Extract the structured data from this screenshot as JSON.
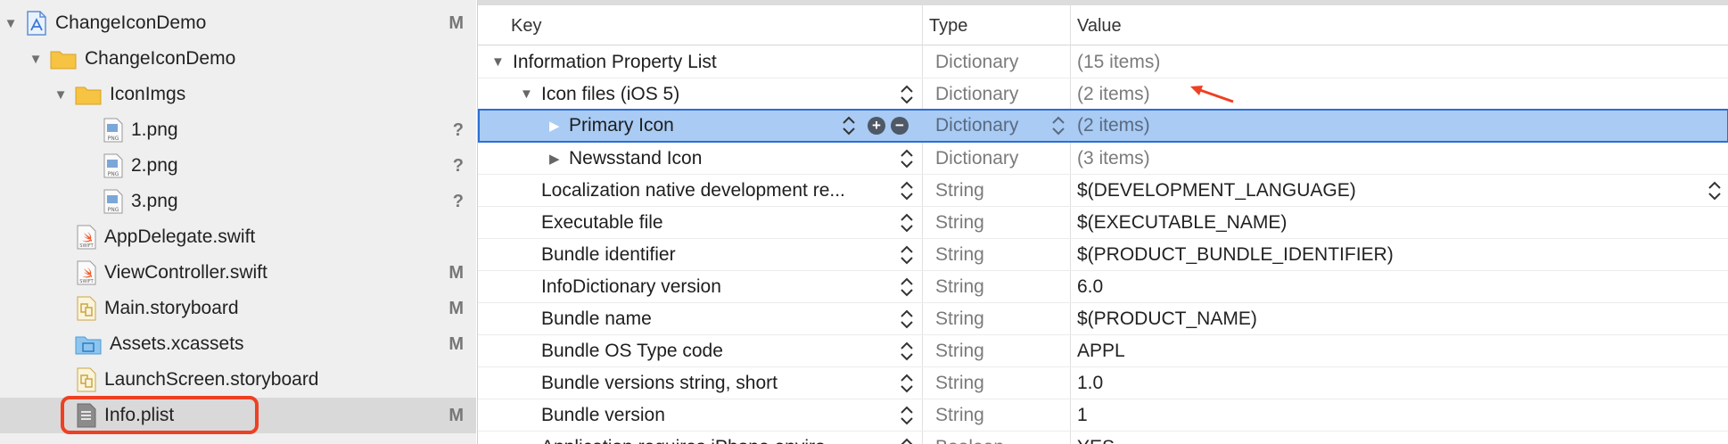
{
  "navigator": {
    "items": [
      {
        "label": "ChangeIconDemo",
        "status": "M"
      },
      {
        "label": "ChangeIconDemo",
        "status": ""
      },
      {
        "label": "IconImgs",
        "status": ""
      },
      {
        "label": "1.png",
        "status": "?"
      },
      {
        "label": "2.png",
        "status": "?"
      },
      {
        "label": "3.png",
        "status": "?"
      },
      {
        "label": "AppDelegate.swift",
        "status": ""
      },
      {
        "label": "ViewController.swift",
        "status": "M"
      },
      {
        "label": "Main.storyboard",
        "status": "M"
      },
      {
        "label": "Assets.xcassets",
        "status": "M"
      },
      {
        "label": "LaunchScreen.storyboard",
        "status": ""
      },
      {
        "label": "Info.plist",
        "status": "M"
      }
    ],
    "icon_names": [
      "project-icon",
      "folder-icon",
      "png-file-icon",
      "swift-file-icon",
      "storyboard-icon",
      "asset-catalog-icon",
      "plist-file-icon"
    ]
  },
  "plist": {
    "headers": {
      "key": "Key",
      "type": "Type",
      "value": "Value"
    },
    "rows": [
      {
        "key": "Information Property List",
        "type": "Dictionary",
        "value": "(15 items)"
      },
      {
        "key": "Icon files (iOS 5)",
        "type": "Dictionary",
        "value": "(2 items)"
      },
      {
        "key": "Primary Icon",
        "type": "Dictionary",
        "value": "(2 items)"
      },
      {
        "key": "Newsstand Icon",
        "type": "Dictionary",
        "value": "(3 items)"
      },
      {
        "key": "Localization native development re...",
        "type": "String",
        "value": "$(DEVELOPMENT_LANGUAGE)"
      },
      {
        "key": "Executable file",
        "type": "String",
        "value": "$(EXECUTABLE_NAME)"
      },
      {
        "key": "Bundle identifier",
        "type": "String",
        "value": "$(PRODUCT_BUNDLE_IDENTIFIER)"
      },
      {
        "key": "InfoDictionary version",
        "type": "String",
        "value": "6.0"
      },
      {
        "key": "Bundle name",
        "type": "String",
        "value": "$(PRODUCT_NAME)"
      },
      {
        "key": "Bundle OS Type code",
        "type": "String",
        "value": "APPL"
      },
      {
        "key": "Bundle versions string, short",
        "type": "String",
        "value": "1.0"
      },
      {
        "key": "Bundle version",
        "type": "String",
        "value": "1"
      },
      {
        "key": "Application requires iPhone enviro...",
        "type": "Boolean",
        "value": "YES"
      }
    ]
  },
  "colors": {
    "selection_fill": "#a9cbf4",
    "selection_border": "#2d6ed6",
    "annotation_red": "#ee4022",
    "navigator_bg": "#efefef"
  }
}
